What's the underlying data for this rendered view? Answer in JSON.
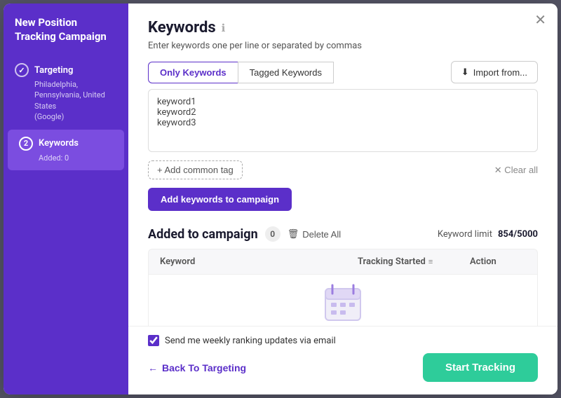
{
  "sidebar": {
    "title": "New Position Tracking Campaign",
    "items": [
      {
        "id": "targeting",
        "step": "check",
        "label": "Targeting",
        "sub": "Philadelphia, Pennsylvania, United States\n(Google)",
        "completed": true,
        "active": false
      },
      {
        "id": "keywords",
        "step": "2",
        "label": "Keywords",
        "sub": "Added: 0",
        "completed": false,
        "active": true
      }
    ]
  },
  "main": {
    "title": "Keywords",
    "info_icon": "ℹ",
    "subtitle": "Enter keywords one per line or separated by commas",
    "tabs": [
      {
        "id": "only-keywords",
        "label": "Only Keywords",
        "active": true
      },
      {
        "id": "tagged-keywords",
        "label": "Tagged Keywords",
        "active": false
      }
    ],
    "import_btn": "Import from...",
    "textarea_placeholder": "keyword1\nkeyword2\nkeyword3",
    "textarea_value": "keyword1\nkeyword2\nkeyword3",
    "add_tag_label": "+ Add common tag",
    "clear_label": "✕ Clear all",
    "add_keywords_btn": "Add keywords to campaign",
    "added_section": {
      "title": "Added to campaign",
      "count": "0",
      "delete_all_label": "Delete All",
      "keyword_limit_label": "Keyword limit",
      "keyword_limit_value": "854/5000",
      "table_headers": {
        "keyword": "Keyword",
        "tracking_started": "Tracking Started",
        "action": "Action"
      }
    }
  },
  "footer": {
    "email_checkbox_label": "Send me weekly ranking updates via email",
    "back_btn": "Back To Targeting",
    "start_btn": "Start Tracking"
  },
  "colors": {
    "sidebar_bg": "#5b2fc9",
    "sidebar_active": "#7b4de0",
    "accent": "#5b2fc9",
    "green": "#2ecc9a"
  }
}
